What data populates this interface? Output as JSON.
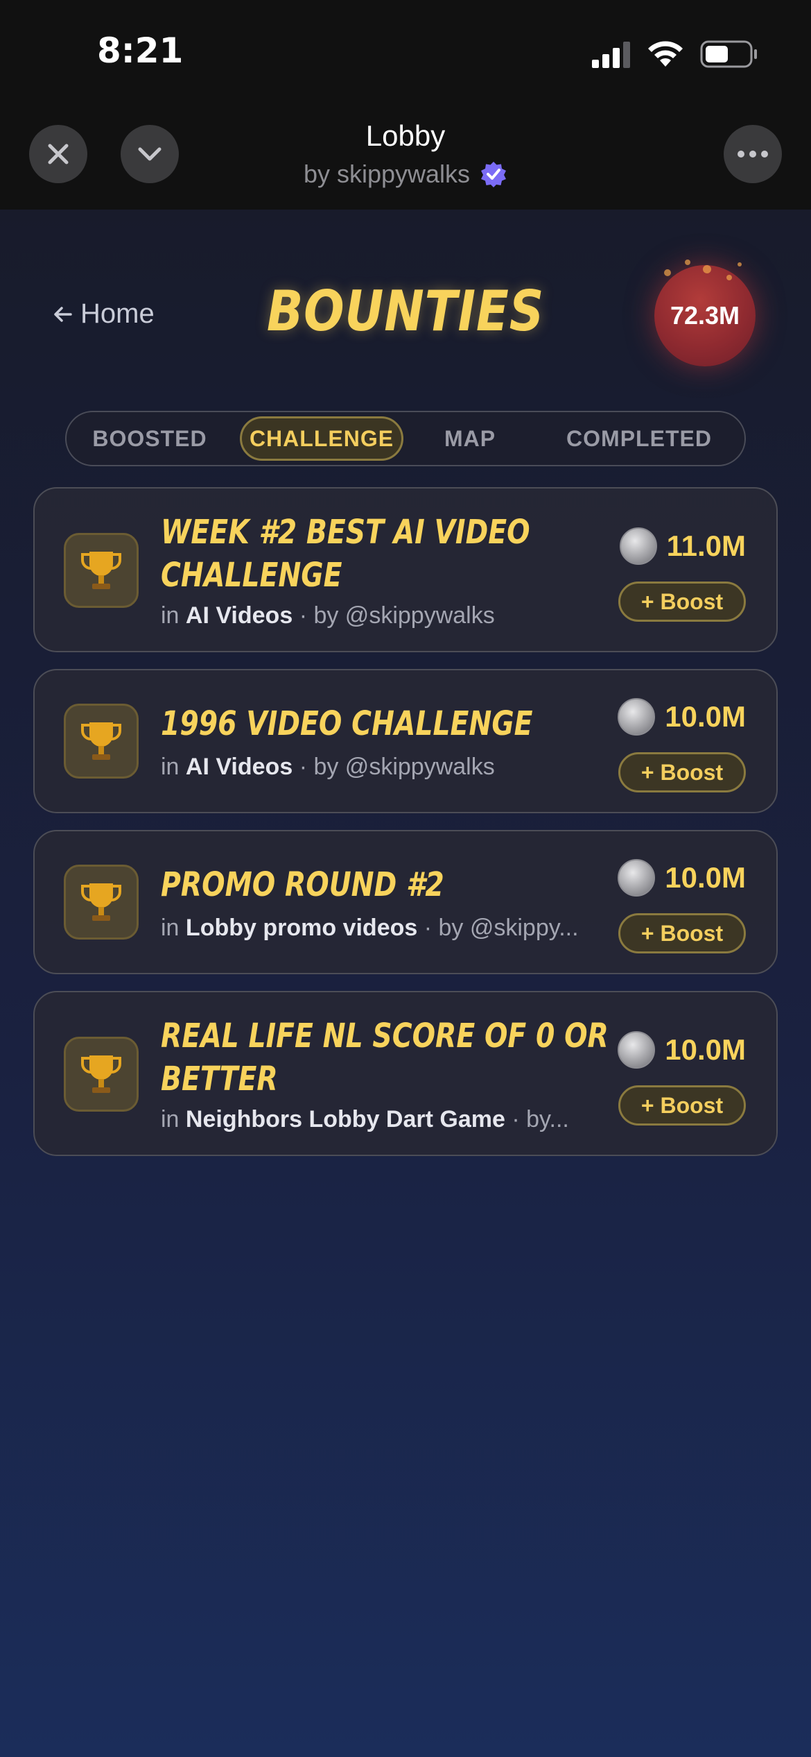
{
  "status_bar": {
    "time": "8:21"
  },
  "header": {
    "title": "Lobby",
    "subtitle": "by skippywalks"
  },
  "page": {
    "home_label": "Home",
    "title": "BOUNTIES",
    "balance": "72.3M"
  },
  "tabs": [
    {
      "label": "BOOSTED",
      "active": false
    },
    {
      "label": "CHALLENGE",
      "active": true
    },
    {
      "label": "MAP",
      "active": false
    },
    {
      "label": "COMPLETED",
      "active": false
    }
  ],
  "bounties": [
    {
      "title_lines": [
        "WEEK #2 BEST AI VIDEO",
        "CHALLENGE"
      ],
      "in_label": "in",
      "category": "AI Videos",
      "author": "· by @skippywalks",
      "reward": "11.0M",
      "boost_label": "+ Boost"
    },
    {
      "title_lines": [
        "1996 VIDEO CHALLENGE"
      ],
      "in_label": "in",
      "category": "AI Videos",
      "author": "· by @skippywalks",
      "reward": "10.0M",
      "boost_label": "+ Boost"
    },
    {
      "title_lines": [
        "PROMO ROUND #2"
      ],
      "in_label": "in",
      "category": "Lobby promo videos",
      "author": "· by @skippy...",
      "reward": "10.0M",
      "boost_label": "+ Boost"
    },
    {
      "title_lines": [
        "REAL LIFE NL SCORE OF 0 OR",
        "BETTER"
      ],
      "in_label": "in",
      "category": "Neighbors Lobby Dart Game",
      "author": "· by...",
      "reward": "10.0M",
      "boost_label": "+ Boost"
    }
  ],
  "colors": {
    "accent_gold": "#f8d35c",
    "verified_purple": "#7b6cf6",
    "balance_red": "#8f2a30"
  },
  "icons": [
    "close-icon",
    "chevron-down-icon",
    "more-icon",
    "back-arrow-icon",
    "verified-badge-icon",
    "trophy-icon",
    "coin-icon",
    "signal-icon",
    "wifi-icon",
    "battery-icon"
  ]
}
